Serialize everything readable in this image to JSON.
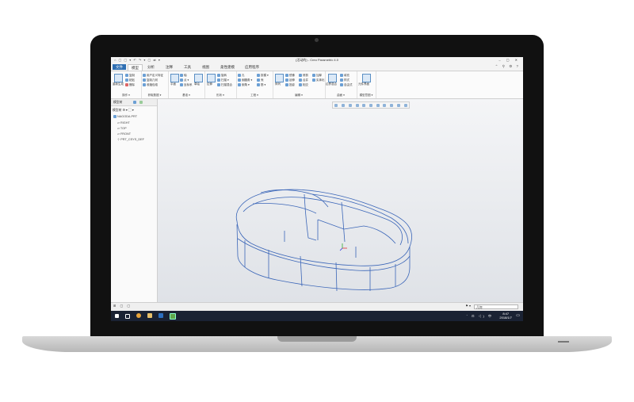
{
  "window": {
    "title": "(活动的) - Creo Parametric 4.0",
    "quick_access": "⌂ ▢ ▢ ▾ ↶ ↷ ▾ ▢ ⇄ ▾",
    "controls": "–  ▢  ✕"
  },
  "tabs": [
    {
      "label": "文件"
    },
    {
      "label": "模型"
    },
    {
      "label": "分析"
    },
    {
      "label": "注释"
    },
    {
      "label": "工具"
    },
    {
      "label": "视图"
    },
    {
      "label": "柔性建模"
    },
    {
      "label": "应用程序"
    }
  ],
  "tab_icons": "⌃ ⚲ ⚙ ?",
  "ribbon": {
    "groups": [
      {
        "label": "操作 ▾",
        "items": [
          "重新生成",
          "▾"
        ],
        "small": [
          "复制",
          "粘贴",
          "删除"
        ]
      },
      {
        "label": "获取数据 ▾",
        "items": [
          "用户定义特征",
          "复制几何",
          "收缩包络"
        ]
      },
      {
        "label": "基准 ▾",
        "items": [
          "平面",
          "轴",
          "点 ▾",
          "坐标系",
          "草绘"
        ]
      },
      {
        "label": "形状 ▾",
        "items": [
          "拉伸",
          "旋转",
          "扫描 ▾",
          "扫描混合"
        ]
      },
      {
        "label": "工程 ▾",
        "items": [
          "孔",
          "倒圆角 ▾",
          "倒角 ▾",
          "拔模 ▾",
          "壳",
          "筋 ▾"
        ]
      },
      {
        "label": "编辑 ▾",
        "items": [
          "阵列",
          "镜像",
          "延伸",
          "投影",
          "修剪",
          "合并",
          "相交",
          "加厚",
          "实体化"
        ]
      },
      {
        "label": "曲面 ▾",
        "items": [
          "边界混合",
          "填充",
          "样式",
          "自由式"
        ]
      },
      {
        "label": "模型意图 ▾",
        "items": [
          "元件界面"
        ]
      }
    ]
  },
  "left_panel": {
    "tab1": "模型树",
    "tab2": "",
    "tree_label": "模型树",
    "tree": [
      {
        "label": "NAGODA.PRT"
      },
      {
        "label": "RIGHT"
      },
      {
        "label": "TOP"
      },
      {
        "label": "FRONT"
      },
      {
        "label": "PRT_CSYS_DEF"
      }
    ]
  },
  "status": {
    "filter": "几何"
  },
  "taskbar": {
    "time": "8:47",
    "date": "2018/1/7",
    "tray": "ˆ ⊡ ◁) 中"
  },
  "colors": {
    "wireframe": "#3b66b8",
    "file_tab": "#2f6fb3",
    "taskbar": "#1a2233"
  }
}
